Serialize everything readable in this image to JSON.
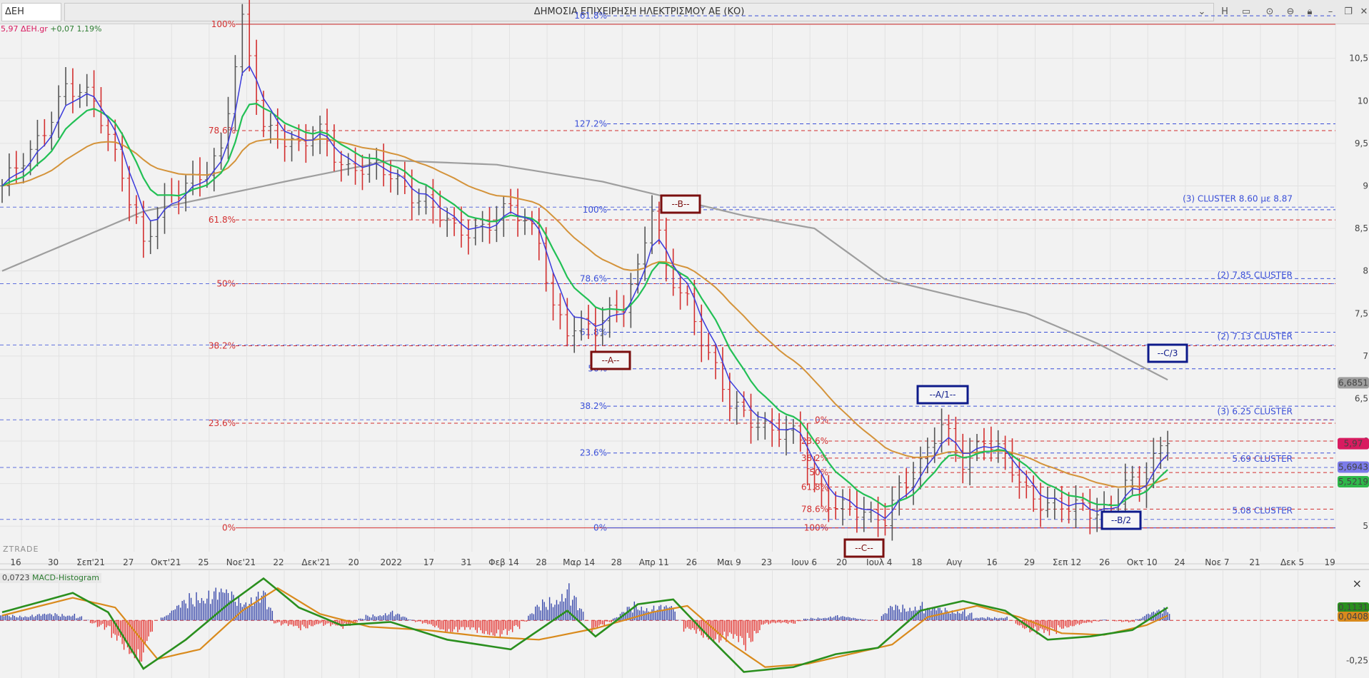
{
  "toolbar": {
    "symbol": "ΔΕΗ",
    "title": "ΔΗΜΟΣΙΑ ΕΠΙΧΕΙΡΗΣΗ ΗΛΕΚΤΡΙΣΜΟΥ ΑΕ (ΚΟ)",
    "btn_h": "H"
  },
  "ticker": {
    "price": "5,97",
    "symbol": "ΔΕΗ.gr",
    "change": "+0,07 1,19%"
  },
  "watermark": "ZTRADE",
  "macd_label": {
    "value": "0,0723",
    "name": "MACD-Histogram"
  },
  "colors": {
    "up_bar": "#555555",
    "down_bar": "#d32f2f",
    "ma_fast": "#3b3bdc",
    "ma_mid": "#22c055",
    "ma_slow": "#d4933a",
    "ma_long": "#9e9e9e",
    "fib_red": "#d32f2f",
    "fib_blue": "#3a4fd8",
    "cluster": "#3a4fd8",
    "wave_red": "#7a0f0f",
    "wave_blue": "#0d1a8a",
    "macd_line": "#2a8f1e",
    "signal_line": "#d98a1c",
    "hist_up": "#3949ab",
    "hist_down": "#e53935"
  },
  "chart_data": {
    "type": "candlestick",
    "title": "ΔΗΜΟΣΙΑ ΕΠΙΧΕΙΡΗΣΗ ΗΛΕΚΤΡΙΣΜΟΥ ΑΕ (ΚΟ)",
    "y_axis": {
      "min": 4.7,
      "max": 10.9,
      "ticks": [
        10.5,
        10,
        9.5,
        9,
        8.5,
        8,
        7.5,
        7,
        6.5,
        6,
        5.5,
        5
      ],
      "tick_labels": [
        "10,5",
        "10",
        "9,5",
        "9",
        "8,5",
        "8",
        "7,5",
        "7",
        "6,5",
        "6",
        "5,5",
        "5"
      ]
    },
    "x_labels": [
      "16",
      "30",
      "Σεπ'21",
      "27",
      "Οκτ'21",
      "25",
      "Νοε'21",
      "22",
      "Δεκ'21",
      "20",
      "2022",
      "17",
      "31",
      "Φεβ 14",
      "28",
      "Μαρ 14",
      "28",
      "Απρ 11",
      "26",
      "Μαι 9",
      "23",
      "Ιουν 6",
      "20",
      "Ιουλ 4",
      "18",
      "Αυγ",
      "16",
      "29",
      "Σεπ 12",
      "26",
      "Οκτ 10",
      "24",
      "Νοε 7",
      "21",
      "Δεκ 5",
      "19"
    ],
    "price_anchors": [
      [
        0,
        9.0
      ],
      [
        4,
        9.35
      ],
      [
        9,
        10.2
      ],
      [
        13,
        9.95
      ],
      [
        17,
        9.2
      ],
      [
        20,
        8.3
      ],
      [
        23,
        8.75
      ],
      [
        26,
        9.05
      ],
      [
        31,
        9.35
      ],
      [
        34,
        10.9
      ],
      [
        37,
        9.75
      ],
      [
        42,
        9.4
      ],
      [
        45,
        9.65
      ],
      [
        49,
        9.2
      ],
      [
        55,
        9.15
      ],
      [
        60,
        8.8
      ],
      [
        64,
        8.45
      ],
      [
        68,
        8.55
      ],
      [
        72,
        8.7
      ],
      [
        76,
        8.4
      ],
      [
        78,
        7.6
      ],
      [
        80,
        7.3
      ],
      [
        84,
        7.3
      ],
      [
        86,
        7.55
      ],
      [
        88,
        7.65
      ],
      [
        90,
        8.0
      ],
      [
        92,
        8.7
      ],
      [
        94,
        8.0
      ],
      [
        97,
        7.7
      ],
      [
        100,
        7.0
      ],
      [
        103,
        6.4
      ],
      [
        107,
        6.25
      ],
      [
        110,
        6.1
      ],
      [
        113,
        6.0
      ],
      [
        115,
        5.45
      ],
      [
        117,
        5.35
      ],
      [
        120,
        5.2
      ],
      [
        123,
        5.05
      ],
      [
        125,
        5.1
      ],
      [
        127,
        5.5
      ],
      [
        130,
        5.7
      ],
      [
        133,
        6.15
      ],
      [
        136,
        5.8
      ],
      [
        139,
        6.05
      ],
      [
        142,
        5.75
      ],
      [
        145,
        5.4
      ],
      [
        148,
        5.3
      ],
      [
        151,
        5.2
      ],
      [
        154,
        5.15
      ],
      [
        157,
        5.25
      ],
      [
        159,
        5.55
      ],
      [
        161,
        5.4
      ],
      [
        163,
        5.75
      ],
      [
        165,
        5.97
      ]
    ],
    "ma_long_anchors": [
      [
        0,
        8.0
      ],
      [
        20,
        8.7
      ],
      [
        40,
        9.05
      ],
      [
        55,
        9.3
      ],
      [
        70,
        9.25
      ],
      [
        85,
        9.05
      ],
      [
        95,
        8.85
      ],
      [
        105,
        8.65
      ],
      [
        115,
        8.5
      ],
      [
        125,
        7.9
      ],
      [
        135,
        7.7
      ],
      [
        145,
        7.5
      ],
      [
        155,
        7.15
      ],
      [
        165,
        6.72
      ]
    ],
    "last_price": 5.97,
    "price_labels": [
      {
        "value": 6.6851,
        "text": "6,6851",
        "color": "#9e9e9e"
      },
      {
        "value": 5.97,
        "text": "5,97",
        "color": "#d81b60"
      },
      {
        "value": 5.6943,
        "text": "5,6943",
        "color": "#7b7bea"
      },
      {
        "value": 5.5219,
        "text": "5,5219",
        "color": "#2eb84a"
      }
    ],
    "fib_red": [
      {
        "label": "100%",
        "value": 10.9
      },
      {
        "label": "78.6%",
        "value": 9.65
      },
      {
        "label": "61.8%",
        "value": 8.6
      },
      {
        "label": "50%",
        "value": 7.85
      },
      {
        "label": "38.2%",
        "value": 7.12
      },
      {
        "label": "23.6%",
        "value": 6.21
      },
      {
        "label": "0%",
        "value": 4.98
      }
    ],
    "fib_blue": [
      {
        "label": "161.8%",
        "value": 11.0
      },
      {
        "label": "127.2%",
        "value": 9.73
      },
      {
        "label": "100%",
        "value": 8.72
      },
      {
        "label": "78.6%",
        "value": 7.91
      },
      {
        "label": "61.8%",
        "value": 7.28
      },
      {
        "label": "50%",
        "value": 6.85
      },
      {
        "label": "38.2%",
        "value": 6.41
      },
      {
        "label": "23.6%",
        "value": 5.86
      },
      {
        "label": "0%",
        "value": 4.98
      }
    ],
    "fib_small": [
      {
        "label": "0%",
        "value": 6.25
      },
      {
        "label": "23.6%",
        "value": 6.0
      },
      {
        "label": "38.2%",
        "value": 5.8
      },
      {
        "label": "50%",
        "value": 5.63
      },
      {
        "label": "61.8%",
        "value": 5.46
      },
      {
        "label": "78.6%",
        "value": 5.2
      },
      {
        "label": "100%",
        "value": 4.98
      }
    ],
    "clusters": [
      {
        "label": "(3) CLUSTER  8.60 με 8.87",
        "value": 8.75
      },
      {
        "label": "(2) 7.85 CLUSTER",
        "value": 7.85
      },
      {
        "label": "(2) 7.13 CLUSTER",
        "value": 7.13
      },
      {
        "label": "(3) 6.25 CLUSTER",
        "value": 6.25
      },
      {
        "label": "5.69 CLUSTER",
        "value": 5.69
      },
      {
        "label": "5.08 CLUSTER",
        "value": 5.08
      }
    ],
    "waves": [
      {
        "label": "--B--",
        "style": "red"
      },
      {
        "label": "--A--",
        "style": "red"
      },
      {
        "label": "--C--",
        "style": "red"
      },
      {
        "label": "--A/1--",
        "style": "blue"
      },
      {
        "label": "--C/3",
        "style": "blue"
      },
      {
        "label": "--B/2",
        "style": "blue"
      }
    ],
    "macd": {
      "y_axis": {
        "min": -0.34,
        "max": 0.28,
        "ticks": [
          -0.25
        ],
        "tick_labels": [
          "-0,25"
        ]
      },
      "macd_anchors": [
        [
          0,
          0.05
        ],
        [
          10,
          0.17
        ],
        [
          15,
          0.05
        ],
        [
          20,
          -0.3
        ],
        [
          26,
          -0.12
        ],
        [
          32,
          0.1
        ],
        [
          37,
          0.26
        ],
        [
          42,
          0.08
        ],
        [
          48,
          -0.03
        ],
        [
          55,
          -0.01
        ],
        [
          63,
          -0.12
        ],
        [
          72,
          -0.18
        ],
        [
          80,
          0.06
        ],
        [
          84,
          -0.1
        ],
        [
          90,
          0.1
        ],
        [
          95,
          0.13
        ],
        [
          100,
          -0.1
        ],
        [
          105,
          -0.32
        ],
        [
          112,
          -0.29
        ],
        [
          118,
          -0.21
        ],
        [
          124,
          -0.17
        ],
        [
          130,
          0.06
        ],
        [
          136,
          0.12
        ],
        [
          142,
          0.06
        ],
        [
          148,
          -0.12
        ],
        [
          154,
          -0.1
        ],
        [
          160,
          -0.06
        ],
        [
          165,
          0.08
        ]
      ],
      "signal_anchors": [
        [
          0,
          0.03
        ],
        [
          10,
          0.14
        ],
        [
          16,
          0.08
        ],
        [
          22,
          -0.24
        ],
        [
          28,
          -0.18
        ],
        [
          34,
          0.06
        ],
        [
          39,
          0.2
        ],
        [
          45,
          0.04
        ],
        [
          52,
          -0.04
        ],
        [
          60,
          -0.06
        ],
        [
          68,
          -0.1
        ],
        [
          76,
          -0.12
        ],
        [
          84,
          -0.05
        ],
        [
          92,
          0.05
        ],
        [
          97,
          0.09
        ],
        [
          103,
          -0.14
        ],
        [
          108,
          -0.29
        ],
        [
          114,
          -0.27
        ],
        [
          120,
          -0.21
        ],
        [
          126,
          -0.15
        ],
        [
          131,
          0.02
        ],
        [
          138,
          0.09
        ],
        [
          144,
          0.02
        ],
        [
          150,
          -0.08
        ],
        [
          156,
          -0.09
        ],
        [
          162,
          -0.03
        ],
        [
          165,
          0.03
        ]
      ],
      "labels": [
        {
          "text": "0,1131",
          "color": "#2a8f1e"
        },
        {
          "text": "0,0408",
          "color": "#d98a1c"
        }
      ]
    }
  }
}
